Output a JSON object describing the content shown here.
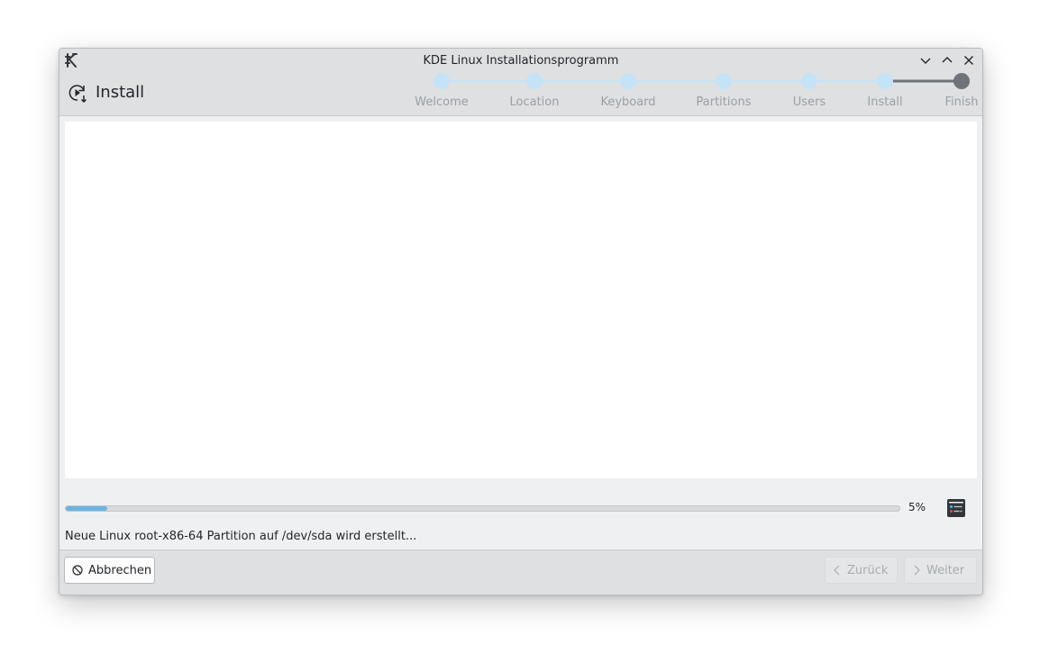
{
  "window": {
    "title": "KDE Linux Installationsprogramm"
  },
  "page": {
    "title": "Install",
    "icon": "install-play-icon"
  },
  "steps": [
    {
      "label": "Welcome",
      "state": "done"
    },
    {
      "label": "Location",
      "state": "done"
    },
    {
      "label": "Keyboard",
      "state": "done"
    },
    {
      "label": "Partitions",
      "state": "done"
    },
    {
      "label": "Users",
      "state": "done"
    },
    {
      "label": "Install",
      "state": "current"
    },
    {
      "label": "Finish",
      "state": "pending"
    }
  ],
  "progress": {
    "value": 5,
    "label": "5%"
  },
  "status": {
    "message": "Neue Linux root-x86-64 Partition auf /dev/sda wird erstellt..."
  },
  "footer": {
    "cancel_label": "Abbrechen",
    "back_label": "Zurück",
    "next_label": "Weiter"
  },
  "colors": {
    "accent": "#6bb4e0",
    "step_done": "#c5e3f6",
    "step_pending": "#6e7479",
    "window_bg": "#eff0f1",
    "header_bg": "#dee0e2"
  }
}
